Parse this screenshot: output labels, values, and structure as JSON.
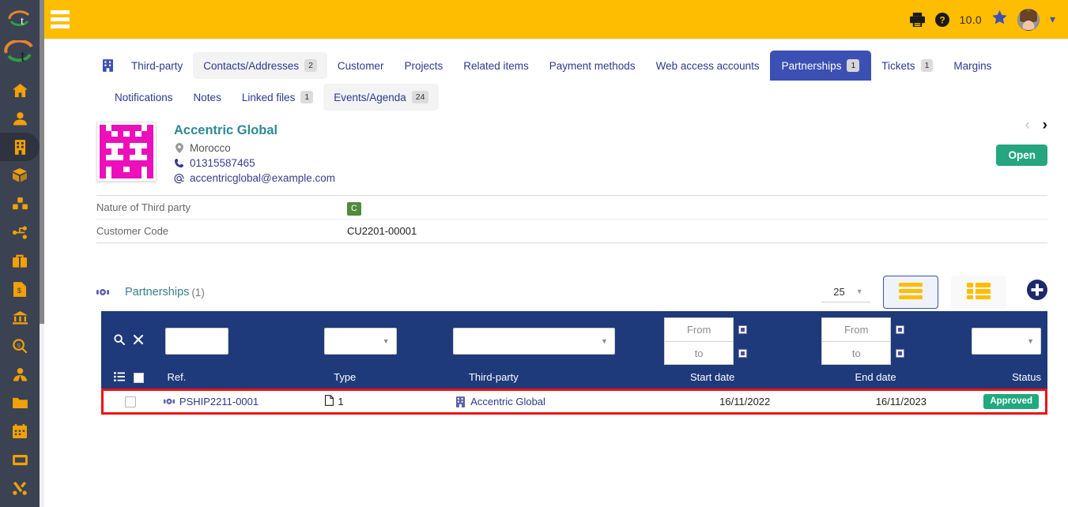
{
  "topbar": {
    "menu_icon": "hamburger-icon",
    "print_icon": "printer-icon",
    "help_icon": "question-circle-icon",
    "version": "10.0",
    "star_icon": "star-icon",
    "avatar": "user-avatar",
    "chevron": "chevron-down-icon"
  },
  "sidebar": {
    "items": [
      {
        "name": "logo-small",
        "icon": "dolibarr-logo-icon"
      },
      {
        "name": "logo-large",
        "icon": "dolibarr-logo-icon"
      },
      {
        "name": "home",
        "icon": "home-icon"
      },
      {
        "name": "members",
        "icon": "user-icon"
      },
      {
        "name": "third-parties",
        "icon": "building-icon",
        "active": true
      },
      {
        "name": "products",
        "icon": "box-icon"
      },
      {
        "name": "stocks",
        "icon": "boxes-icon"
      },
      {
        "name": "projects",
        "icon": "project-nodes-icon"
      },
      {
        "name": "commercial",
        "icon": "briefcase-icon"
      },
      {
        "name": "billing",
        "icon": "invoice-icon"
      },
      {
        "name": "bank",
        "icon": "bank-icon"
      },
      {
        "name": "accounting",
        "icon": "dollar-search-icon"
      },
      {
        "name": "hrm",
        "icon": "employee-icon"
      },
      {
        "name": "documents",
        "icon": "folder-icon"
      },
      {
        "name": "agenda",
        "icon": "calendar-icon"
      },
      {
        "name": "ticket",
        "icon": "ticket-icon"
      },
      {
        "name": "tools",
        "icon": "tools-icon"
      }
    ]
  },
  "tabs": {
    "row1": [
      {
        "label": "",
        "icon": "building-icon",
        "icon_only": true,
        "badge": null,
        "state": "plain"
      },
      {
        "label": "Third-party",
        "badge": null,
        "state": "plain"
      },
      {
        "label": "Contacts/Addresses",
        "badge": "2",
        "state": "soft"
      },
      {
        "label": "Customer",
        "badge": null,
        "state": "plain"
      },
      {
        "label": "Projects",
        "badge": null,
        "state": "plain"
      },
      {
        "label": "Related items",
        "badge": null,
        "state": "plain"
      },
      {
        "label": "Payment methods",
        "badge": null,
        "state": "plain"
      },
      {
        "label": "Web access accounts",
        "badge": null,
        "state": "plain"
      },
      {
        "label": "Partnerships",
        "badge": "1",
        "state": "active"
      },
      {
        "label": "Tickets",
        "badge": "1",
        "state": "plain"
      },
      {
        "label": "Margins",
        "badge": null,
        "state": "plain"
      }
    ],
    "row2": [
      {
        "label": "Notifications",
        "badge": null,
        "state": "plain"
      },
      {
        "label": "Notes",
        "badge": null,
        "state": "plain"
      },
      {
        "label": "Linked files",
        "badge": "1",
        "state": "plain"
      },
      {
        "label": "Events/Agenda",
        "badge": "24",
        "state": "soft"
      }
    ]
  },
  "company": {
    "name": "Accentric Global",
    "country": "Morocco",
    "phone": "01315587465",
    "email": "accentricglobal@example.com",
    "location_icon": "map-pin-icon",
    "phone_icon": "phone-icon",
    "email_icon": "at-sign-icon",
    "prev_arrow": "chevron-left-icon",
    "next_arrow": "chevron-right-icon",
    "open_button": "Open"
  },
  "info": {
    "rows": [
      {
        "label": "Nature of Third party",
        "value": "C",
        "badge": true
      },
      {
        "label": "Customer Code",
        "value": "CU2201-00001",
        "badge": false
      }
    ]
  },
  "section": {
    "icon": "handshake-icon",
    "title": "Partnerships",
    "count": "(1)",
    "per_page": "25",
    "per_page_caret": "chevron-down-icon",
    "list_view_icon": "list-view-icon",
    "grid_view_icon": "grid-view-icon",
    "add_icon": "plus-circle-icon"
  },
  "table": {
    "search_icon": "search-icon",
    "clear_icon": "clear-x-icon",
    "header_list_icon": "column-selector-icon",
    "header_checkbox": "select-all-checkbox",
    "columns": [
      {
        "key": "ref",
        "label": "Ref."
      },
      {
        "key": "type",
        "label": "Type"
      },
      {
        "key": "third",
        "label": "Third-party"
      },
      {
        "key": "start",
        "label": "Start date"
      },
      {
        "key": "end",
        "label": "End date"
      },
      {
        "key": "status",
        "label": "Status"
      }
    ],
    "filters": {
      "ref": "",
      "type": "",
      "third": "",
      "start_from": "From",
      "start_to": "to",
      "end_from": "From",
      "end_to": "to",
      "status": "",
      "calendar_icon": "calendar-picker-icon"
    },
    "rows": [
      {
        "ref": "PSHIP2211-0001",
        "ref_icon": "handshake-icon",
        "type": "1",
        "type_icon": "document-icon",
        "third": "Accentric Global",
        "third_icon": "building-icon",
        "start": "16/11/2022",
        "end": "16/11/2023",
        "status": "Approved"
      }
    ]
  },
  "colors": {
    "topbar": "#ffbd00",
    "sidebar": "#3b4252",
    "accent_blue": "#3c50b4",
    "table_header": "#1e3a7b",
    "highlight_red": "#ee1111",
    "status_green": "#1fa97f",
    "open_green": "#25a67e",
    "company_teal": "#2f8a95",
    "identicon": "#ec0fbb"
  }
}
